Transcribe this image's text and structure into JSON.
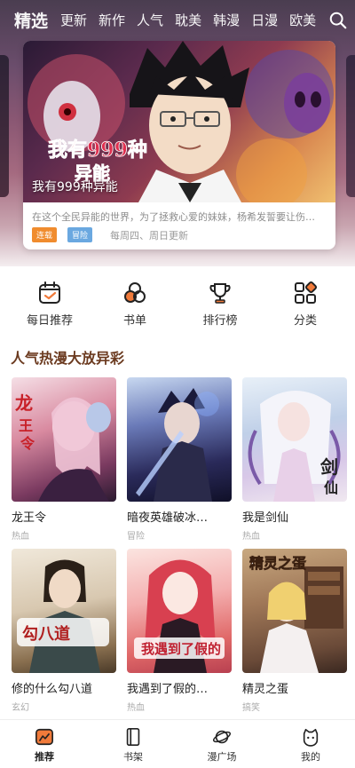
{
  "topnav": {
    "tabs": [
      {
        "label": "精选",
        "active": true
      },
      {
        "label": "更新"
      },
      {
        "label": "新作"
      },
      {
        "label": "人气"
      },
      {
        "label": "耽美"
      },
      {
        "label": "韩漫"
      },
      {
        "label": "日漫"
      },
      {
        "label": "欧美"
      }
    ]
  },
  "banner": {
    "title": "我有999种异能",
    "description": "在这个全民异能的世界，为了拯救心爱的妹妹，杨希发誓要让伤…",
    "badges": [
      "连载",
      "冒险"
    ],
    "update": "每周四、周日更新"
  },
  "quick": {
    "daily": "每日推荐",
    "booklist": "书单",
    "ranking": "排行榜",
    "category": "分类"
  },
  "section": {
    "title": "人气热漫大放异彩",
    "items": [
      {
        "name": "龙王令",
        "tag": "热血"
      },
      {
        "name": "暗夜英雄破冰…",
        "tag": "冒险"
      },
      {
        "name": "我是剑仙",
        "tag": "热血"
      },
      {
        "name": "修的什么勾八道",
        "tag": "玄幻"
      },
      {
        "name": "我遇到了假的…",
        "tag": "热血"
      },
      {
        "name": "精灵之蛋",
        "tag": "搞笑"
      }
    ]
  },
  "tabbar": {
    "recommend": "推荐",
    "shelf": "书架",
    "square": "漫广场",
    "mine": "我的"
  },
  "colors": {
    "section_title": "#6b3a1f",
    "badge_orange": "#f08c2e",
    "badge_blue": "#6aa8e0",
    "accent": "#f07a3a"
  }
}
